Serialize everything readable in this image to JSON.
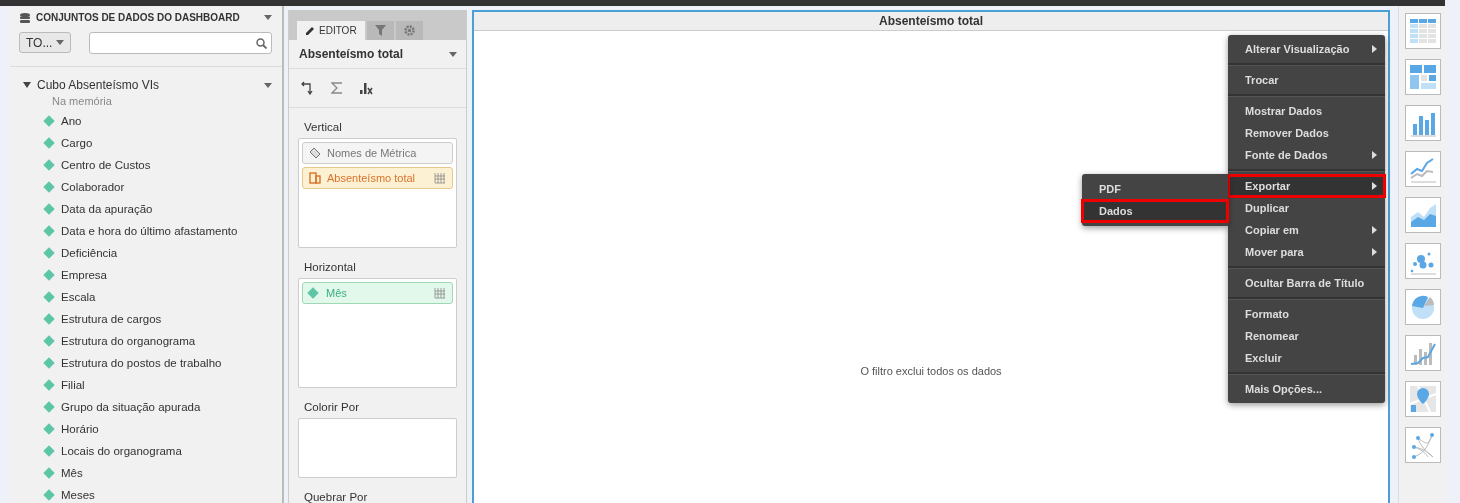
{
  "datasets": {
    "title": "CONJUNTOS DE DADOS DO DASHBOARD",
    "filter": "TO...",
    "cube": {
      "name": "Cubo Absenteísmo VIs",
      "expanded": true,
      "subtitle": "Na memória",
      "fields": [
        "Ano",
        "Cargo",
        "Centro de Custos",
        "Colaborador",
        "Data da apuração",
        "Data e hora do último afastamento",
        "Deficiência",
        "Empresa",
        "Escala",
        "Estrutura de cargos",
        "Estrutura do organograma",
        "Estrutura do postos de trabalho",
        "Filial",
        "Grupo da situação apurada",
        "Horário",
        "Locais do organograma",
        "Mês",
        "Meses"
      ]
    }
  },
  "editor": {
    "tabs": [
      {
        "kind": "editor",
        "label": "EDITOR",
        "selected": true
      },
      {
        "kind": "filter",
        "selected": false
      },
      {
        "kind": "settings",
        "selected": false
      }
    ],
    "title": "Absenteísmo total",
    "zones": [
      {
        "label": "Vertical",
        "items": [
          {
            "kind": "metric_names",
            "label": "Nomes de Métrica"
          },
          {
            "kind": "metric",
            "label": "Absenteísmo total"
          }
        ]
      },
      {
        "label": "Horizontal",
        "items": [
          {
            "kind": "attribute",
            "label": "Mês"
          }
        ]
      },
      {
        "label": "Colorir Por"
      },
      {
        "label": "Quebrar Por"
      }
    ]
  },
  "visualization": {
    "title": "Absenteísmo total",
    "message": "O filtro exclui todos os dados"
  },
  "context_menu": {
    "groups": [
      [
        {
          "label": "Alterar Visualização",
          "submenu": true,
          "selected": false,
          "highlighted": false
        }
      ],
      [
        {
          "label": "Trocar",
          "submenu": false,
          "selected": false,
          "highlighted": false
        }
      ],
      [
        {
          "label": "Mostrar Dados",
          "submenu": false,
          "selected": false,
          "highlighted": false
        },
        {
          "label": "Remover Dados",
          "submenu": false,
          "selected": false,
          "highlighted": false
        },
        {
          "label": "Fonte de Dados",
          "submenu": true,
          "selected": false,
          "highlighted": false
        }
      ],
      [
        {
          "label": "Exportar",
          "submenu": true,
          "selected": true,
          "highlighted": true
        },
        {
          "label": "Duplicar",
          "submenu": false,
          "selected": false,
          "highlighted": false
        },
        {
          "label": "Copiar em",
          "submenu": true,
          "selected": false,
          "highlighted": false
        },
        {
          "label": "Mover para",
          "submenu": true,
          "selected": false,
          "highlighted": false
        }
      ],
      [
        {
          "label": "Ocultar Barra de Título",
          "submenu": false,
          "selected": false,
          "highlighted": false
        }
      ],
      [
        {
          "label": "Formato",
          "submenu": false,
          "selected": false,
          "highlighted": false
        },
        {
          "label": "Renomear",
          "submenu": false,
          "selected": false,
          "highlighted": false
        },
        {
          "label": "Excluir",
          "submenu": false,
          "selected": false,
          "highlighted": false
        }
      ],
      [
        {
          "label": "Mais Opções...",
          "submenu": false,
          "selected": false,
          "highlighted": false
        }
      ]
    ],
    "submenu": [
      {
        "label": "PDF",
        "selected": false,
        "highlighted": false
      },
      {
        "label": "Dados",
        "selected": true,
        "highlighted": true
      }
    ]
  },
  "chart_types": [
    {
      "kind": "grid"
    },
    {
      "kind": "heatmap"
    },
    {
      "kind": "bar"
    },
    {
      "kind": "line"
    },
    {
      "kind": "area"
    },
    {
      "kind": "bubble"
    },
    {
      "kind": "pie"
    },
    {
      "kind": "combo"
    },
    {
      "kind": "map"
    },
    {
      "kind": "network"
    }
  ]
}
